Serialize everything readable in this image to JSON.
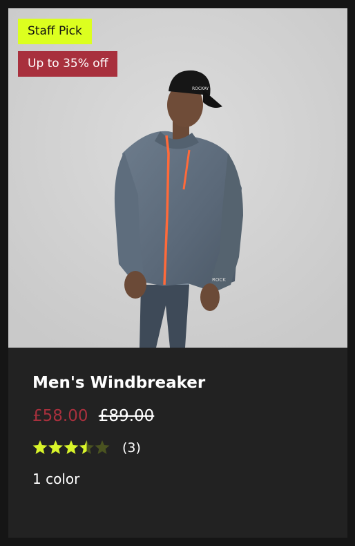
{
  "product": {
    "badges": {
      "staff_pick": "Staff Pick",
      "sale": "Up to 35% off"
    },
    "image_alt": "Man wearing grey windbreaker with orange zip and black cap",
    "cap_text": "ROCKAY",
    "sleeve_text": "ROCK",
    "title": "Men's Windbreaker",
    "price_sale": "£58.00",
    "price_original": "£89.00",
    "rating": 3.5,
    "rating_max": 5,
    "review_count": "(3)",
    "colors_label": "1 color"
  },
  "colors": {
    "staff_pick_bg": "#dcff1f",
    "sale_bg": "#a8303d",
    "sale_price": "#a8303d",
    "star_filled": "#d9f52a",
    "star_empty": "#4a5320",
    "card_bg": "#222222",
    "page_bg": "#151515"
  }
}
